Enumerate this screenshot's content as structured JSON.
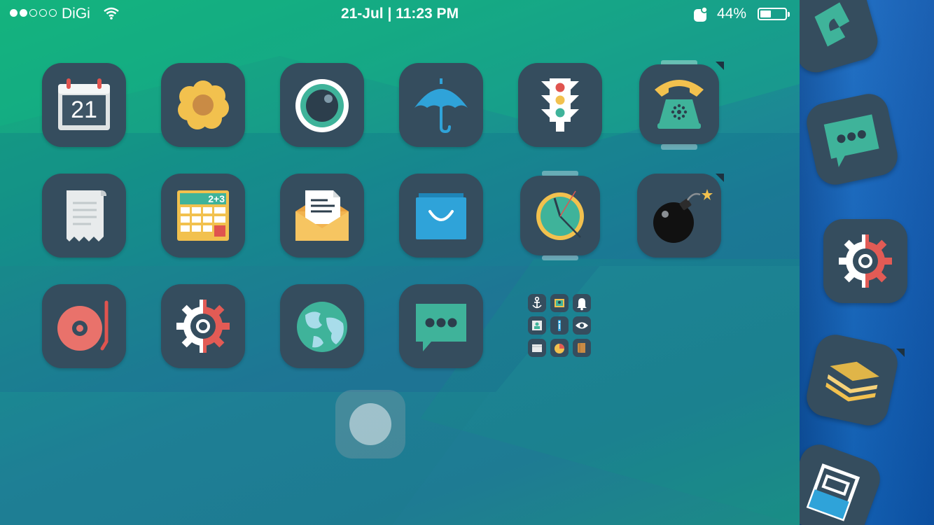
{
  "status_bar": {
    "carrier": "DiGi",
    "signal_bars": 2,
    "signal_total": 5,
    "datetime": "21-Jul | 11:23 PM",
    "battery_percent": "44%",
    "battery_level": 0.44
  },
  "calendar_icon": {
    "day": "21"
  },
  "calculator_icon": {
    "display": "2+3"
  },
  "apps": [
    {
      "icon": "calendar-icon"
    },
    {
      "icon": "flower-icon"
    },
    {
      "icon": "camera-lens-icon"
    },
    {
      "icon": "umbrella-icon"
    },
    {
      "icon": "traffic-light-icon"
    },
    {
      "icon": "telephone-icon"
    },
    {
      "icon": "receipt-icon"
    },
    {
      "icon": "calculator-icon"
    },
    {
      "icon": "mail-envelope-icon"
    },
    {
      "icon": "shopping-bag-icon"
    },
    {
      "icon": "clock-icon"
    },
    {
      "icon": "bomb-icon"
    },
    {
      "icon": "record-player-icon"
    },
    {
      "icon": "settings-gear-icon"
    },
    {
      "icon": "globe-icon"
    },
    {
      "icon": "messages-icon"
    }
  ],
  "folder_mini_icons": [
    "anchor-icon",
    "photo-frame-icon",
    "bell-icon",
    "contact-card-icon",
    "info-icon",
    "eye-icon",
    "card-icon",
    "pie-chart-icon",
    "book-icon"
  ],
  "switcher_icons": [
    "phone-icon",
    "messages-icon",
    "settings-gear-icon",
    "stack-layers-icon",
    "archive-box-icon"
  ],
  "colors": {
    "icon_tile": "#354d5e",
    "accent_teal": "#3fb39a",
    "accent_yellow": "#f2c14e",
    "accent_red": "#e25b55",
    "accent_blue": "#2fa3d9"
  }
}
